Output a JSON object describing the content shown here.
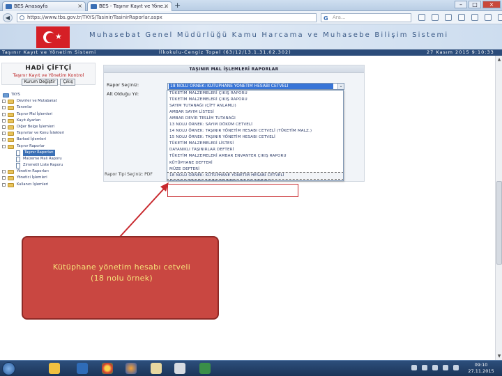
{
  "browser": {
    "tabs": [
      {
        "label": "BES Anasayfa",
        "active": false
      },
      {
        "label": "BES - Taşınır Kayıt ve Yöne...",
        "active": true
      }
    ],
    "new_tab_label": "+",
    "url": "https://www.tbs.gov.tr/TKYS/Tasinir/TasinirRaporlar.aspx",
    "search_placeholder": "Ara..."
  },
  "site": {
    "title": "Muhasebat Genel Müdürlüğü Kamu Harcama ve Muhasebe Bilişim Sistemi",
    "subtitle_left": "Taşınır Kayıt ve Yönetim Sistemi",
    "subtitle_center": "İlkokulu-Cengiz Topel (63/12/13.1.31.02.302)",
    "subtitle_right": "27 Kasım 2015 9:10:33"
  },
  "user": {
    "name": "HADİ ÇİFTÇİ",
    "links": "Taşınır Kayıt ve Yönetim Kontrol",
    "buttons": [
      "Kurum Değiştir",
      "Çıkış"
    ]
  },
  "tree": [
    {
      "label": "TKYS",
      "level": 0,
      "type": "root"
    },
    {
      "label": "Devirler ve Mutabakat",
      "level": 0,
      "type": "folder"
    },
    {
      "label": "Tanımlar",
      "level": 0,
      "type": "folder"
    },
    {
      "label": "Taşınır Mal İşlemleri",
      "level": 0,
      "type": "folder"
    },
    {
      "label": "Kayıt Ayarları",
      "level": 0,
      "type": "folder"
    },
    {
      "label": "Diğer Belge İşlemleri",
      "level": 0,
      "type": "folder"
    },
    {
      "label": "Taşınırlar ve Konu İstekleri",
      "level": 0,
      "type": "folder"
    },
    {
      "label": "Barkod İşlemleri",
      "level": 0,
      "type": "folder"
    },
    {
      "label": "Taşınır Raporlar",
      "level": 0,
      "type": "folder"
    },
    {
      "label": "Taşınır Raporları",
      "level": 1,
      "type": "doc",
      "selected": true
    },
    {
      "label": "Malzeme Mali Raporu",
      "level": 1,
      "type": "doc"
    },
    {
      "label": "Zimmetli Liste Raporu",
      "level": 1,
      "type": "doc"
    },
    {
      "label": "Yönetim Raporları",
      "level": 0,
      "type": "folder"
    },
    {
      "label": "Yönetici İşlemleri",
      "level": 0,
      "type": "folder"
    },
    {
      "label": "Kullanıcı İşlemleri",
      "level": 0,
      "type": "folder"
    }
  ],
  "reports": {
    "header": "TAŞINIR MAL İŞLEMLERİ RAPORLAR",
    "label_report": "Rapor Seçiniz:",
    "label_sub": "Alt Olduğu Yıl:",
    "label_type": "Rapor Tipi Seçiniz: PDF",
    "selected_value": "18 NOLU ÖRNEK: KÜTÜPHANE YÖNETİM HESABI CETVELİ",
    "dropdown_arrow": "⌄",
    "options": [
      "TÜKETİM MALZEMELERİ ÇIKIŞ RAPORU",
      "TÜKETİM MALZEMELERİ ÇIKIŞ RAPORU",
      "SAYIM TUTANAĞI (ÇİFT ANLAMLI)",
      "AMBAR SAYIM LİSTESİ",
      "AMBAR DEVİR TESLİM TUTANAĞI",
      "13 NOLU ÖRNEK: SAYIM DÖKÜM CETVELİ",
      "14 NOLU ÖRNEK: TAŞINIR YÖNETİM HESABI CETVELİ (TÜKETİM MALZ.)",
      "15 NOLU ÖRNEK: TAŞINIR YÖNETİM HESABI CETVELİ",
      "TÜKETİM MALZEMELERİ LİSTESİ",
      "DAYANIKLI TAŞINIRLAR DEFTERİ",
      "TÜKETİM MALZEMELERİ AMBAR ENVANTER ÇIKIŞ RAPORU",
      "KÜTÜPHANE DEFTERİ",
      "MÜZE DEFTERİ",
      "18 NOLU ÖRNEK: KÜTÜPHANE YÖNETİM HESABI CETVELİ",
      "19 NOLU ÖRNEK: MÜZE YÖNETİM HESABI CETVELİ"
    ],
    "highlighted_index": 13
  },
  "callout": {
    "line1": "Kütüphane yönetim hesabı cetveli",
    "line2": "(18 nolu örnek)"
  },
  "taskbar": {
    "time": "09:10",
    "date": "27.11.2015"
  },
  "colors": {
    "accent": "#3875d7",
    "callout_bg": "#c94741",
    "callout_text": "#f6e27a",
    "highlight_border": "#c8282d"
  }
}
